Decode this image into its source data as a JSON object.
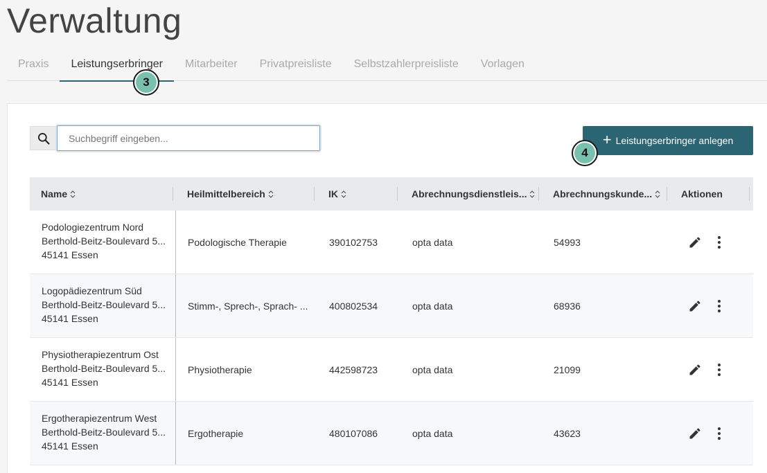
{
  "page": {
    "title": "Verwaltung"
  },
  "tabs": [
    {
      "label": "Praxis"
    },
    {
      "label": "Leistungserbringer"
    },
    {
      "label": "Mitarbeiter"
    },
    {
      "label": "Privatpreisliste"
    },
    {
      "label": "Selbstzahlerpreisliste"
    },
    {
      "label": "Vorlagen"
    }
  ],
  "active_tab": "Leistungserbringer",
  "search": {
    "placeholder": "Suchbegriff eingeben...",
    "value": ""
  },
  "add_button": {
    "label": "Leistungserbringer anlegen"
  },
  "markers": {
    "tab_marker": "3",
    "button_marker": "4"
  },
  "table": {
    "columns": [
      {
        "label": "Name"
      },
      {
        "label": "Heilmittelbereich"
      },
      {
        "label": "IK"
      },
      {
        "label": "Abrechnungsdienstleis..."
      },
      {
        "label": "Abrechnungskunde..."
      },
      {
        "label": "Aktionen"
      }
    ],
    "rows": [
      {
        "name": "Podologiezentrum Nord",
        "street": "Berthold-Beitz-Boulevard 5...",
        "city": "45141 Essen",
        "bereich": "Podologische Therapie",
        "ik": "390102753",
        "dienstleister": "opta data",
        "kunde": "54993"
      },
      {
        "name": "Logopädiezentrum Süd",
        "street": "Berthold-Beitz-Boulevard 5...",
        "city": "45141 Essen",
        "bereich": "Stimm-, Sprech-, Sprach- ...",
        "ik": "400802534",
        "dienstleister": "opta data",
        "kunde": "68936"
      },
      {
        "name": "Physiotherapiezentrum Ost",
        "street": "Berthold-Beitz-Boulevard 5...",
        "city": "45141 Essen",
        "bereich": "Physiotherapie",
        "ik": "442598723",
        "dienstleister": "opta data",
        "kunde": "21099"
      },
      {
        "name": "Ergotherapiezentrum West",
        "street": "Berthold-Beitz-Boulevard 5...",
        "city": "45141 Essen",
        "bereich": "Ergotherapie",
        "ik": "480107086",
        "dienstleister": "opta data",
        "kunde": "43623"
      }
    ]
  },
  "icons": {
    "search": "search-icon",
    "edit": "pencil-icon",
    "more": "more-vertical-icon",
    "add": "plus-icon",
    "sort": "sort-icon"
  },
  "colors": {
    "accent": "#2b6573",
    "marker": "#7ac0ae"
  }
}
